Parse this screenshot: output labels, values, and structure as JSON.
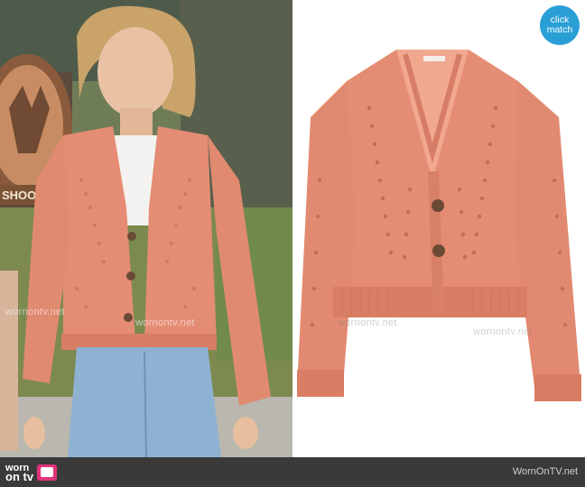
{
  "scene_sign": {
    "text": "SHOOTIN"
  },
  "product_button": {
    "line1": "click",
    "line2": "match"
  },
  "watermark": {
    "text": "wornontv.net"
  },
  "footer": {
    "logo_line1": "worn",
    "logo_line2": "on tv",
    "site": "WornOnTV.net"
  },
  "colors": {
    "sweater": "#e58d74",
    "button_blue": "#2a9fd6",
    "footer_bg": "#3a3a3a",
    "logo_pink": "#e0337a"
  }
}
